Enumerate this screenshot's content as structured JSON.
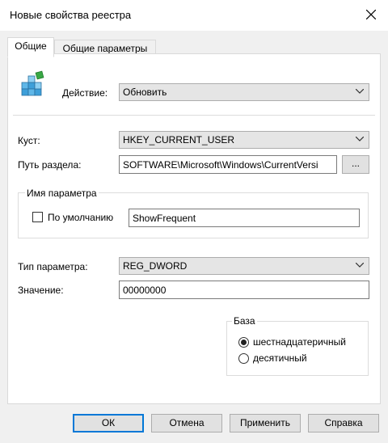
{
  "window": {
    "title": "Новые свойства реестра"
  },
  "tabs": [
    {
      "label": "Общие"
    },
    {
      "label": "Общие параметры"
    }
  ],
  "general": {
    "action": {
      "label": "Действие:",
      "value": "Обновить"
    },
    "hive": {
      "label": "Куст:",
      "value": "HKEY_CURRENT_USER"
    },
    "key_path": {
      "label": "Путь раздела:",
      "value": "SOFTWARE\\Microsoft\\Windows\\CurrentVersi",
      "browse_label": "..."
    },
    "value_name": {
      "legend": "Имя параметра",
      "default_label": "По умолчанию",
      "default_checked": false,
      "value": "ShowFrequent"
    },
    "value_type": {
      "label": "Тип параметра:",
      "value": "REG_DWORD"
    },
    "value_data": {
      "label": "Значение:",
      "value": "00000000"
    },
    "base": {
      "legend": "База",
      "options": [
        {
          "label": "шестнадцатеричный",
          "selected": true
        },
        {
          "label": "десятичный",
          "selected": false
        }
      ]
    }
  },
  "buttons": {
    "ok": "ОК",
    "cancel": "Отмена",
    "apply": "Применить",
    "help": "Справка"
  },
  "colors": {
    "focus_border": "#0078d7",
    "dropdown_bg": "#e5e5e5",
    "dialog_bg": "#f0f0f0"
  }
}
